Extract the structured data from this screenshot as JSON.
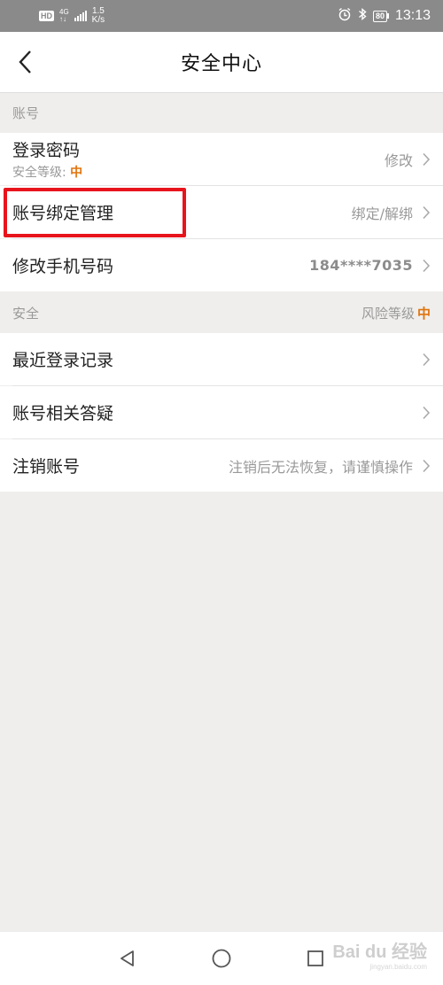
{
  "status_bar": {
    "hd_badge": "HD",
    "network_type_top": "4G",
    "network_type_bottom": "↑↓",
    "speed_value": "1.5",
    "speed_unit": "K/s",
    "battery_level": "80",
    "time": "13:13",
    "icons": [
      "alarm-icon",
      "bluetooth-icon"
    ]
  },
  "header": {
    "title": "安全中心",
    "back_icon": "chevron-left-icon"
  },
  "account_section": {
    "title": "账号",
    "rows": [
      {
        "label": "登录密码",
        "sub_prefix": "安全等级: ",
        "sub_level": "中",
        "action": "修改"
      },
      {
        "label": "账号绑定管理",
        "action": "绑定/解绑"
      },
      {
        "label": "修改手机号码",
        "action": "184****7035"
      }
    ]
  },
  "security_section": {
    "title": "安全",
    "risk_label": "风险等级",
    "risk_level": "中",
    "rows": [
      {
        "label": "最近登录记录",
        "action": ""
      },
      {
        "label": "账号相关答疑",
        "action": ""
      },
      {
        "label": "注销账号",
        "action": "注销后无法恢复，请谨慎操作"
      }
    ]
  },
  "nav_bar": {
    "buttons": [
      "back-triangle-icon",
      "home-circle-icon",
      "recents-square-icon"
    ]
  },
  "watermark": {
    "text": "Bai du 经验",
    "sub": "jingyan.baidu.com"
  },
  "colors": {
    "accent_level": "#e0740c",
    "highlight_border": "#e8141c",
    "status_bar_bg": "#8a8a8a",
    "page_bg": "#efeeec"
  }
}
